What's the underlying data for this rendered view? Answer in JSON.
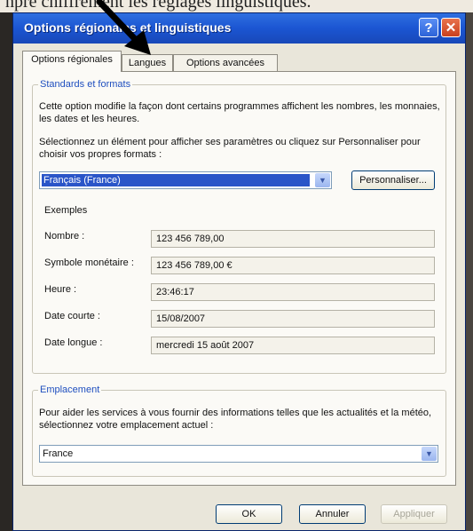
{
  "background_text": "npre chiffrement les réglages linguistiques.",
  "window": {
    "title": "Options régionales et linguistiques",
    "help_symbol": "?",
    "close_symbol": "✕"
  },
  "tabs": [
    "Options régionales",
    "Langues",
    "Options avancées"
  ],
  "standards": {
    "legend": "Standards et formats",
    "description": "Cette option modifie la façon dont certains programmes affichent les nombres, les monnaies, les dates et les heures.",
    "instruction": "Sélectionnez un élément pour afficher ses paramètres ou cliquez sur Personnaliser pour choisir vos propres formats :",
    "selected_format": "Français (France)",
    "customize_label": "Personnaliser...",
    "examples_heading": "Exemples",
    "examples": [
      {
        "label": "Nombre :",
        "value": "123 456 789,00"
      },
      {
        "label": "Symbole monétaire :",
        "value": "123 456 789,00 €"
      },
      {
        "label": "Heure :",
        "value": "23:46:17"
      },
      {
        "label": "Date courte :",
        "value": "15/08/2007"
      },
      {
        "label": "Date longue :",
        "value": "mercredi 15 août 2007"
      }
    ]
  },
  "location": {
    "legend": "Emplacement",
    "description": "Pour aider les services à vous fournir des informations telles que les actualités et la météo, sélectionnez votre emplacement actuel :",
    "selected": "France"
  },
  "footer": {
    "ok_label": "OK",
    "cancel_label": "Annuler",
    "apply_label": "Appliquer"
  },
  "colors": {
    "titlebar": "#1b55d2",
    "group_legend": "#1f4fbf",
    "selection": "#2a55c8",
    "close_button": "#c9401d"
  }
}
